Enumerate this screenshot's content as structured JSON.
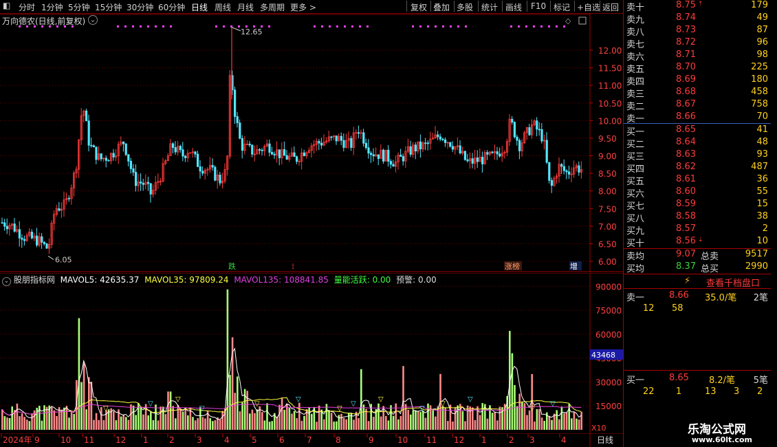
{
  "toolbar": {
    "periods": [
      "分时",
      "1分钟",
      "5分钟",
      "15分钟",
      "30分钟",
      "60分钟",
      "日线",
      "周线",
      "月线",
      "多周期",
      "更多 >"
    ],
    "active": "日线",
    "actions": [
      "复权",
      "叠加",
      "多股",
      "统计",
      "画线",
      "F10",
      "标记",
      "+自选",
      "返回"
    ]
  },
  "main": {
    "title": "万向德农(日线,前复权)",
    "y_ticks": [
      "12.00",
      "11.50",
      "11.00",
      "10.50",
      "10.00",
      "9.50",
      "9.00",
      "8.50",
      "8.00",
      "7.50",
      "7.00",
      "6.50",
      "6.00"
    ],
    "high_label": "12.65",
    "low_label": "6.05",
    "markers": [
      "跌",
      "涨榜",
      "增"
    ]
  },
  "indicator": {
    "name": "股朋指标网",
    "mavol5": "MAVOL5: 42635.37",
    "mavol35": "MAVOL35: 97809.24",
    "mavol135": "MAVOL135: 108841.85",
    "active": "量能活跃: 0.00",
    "warning": "预警: 0.00",
    "y_ticks": [
      "90000",
      "75000",
      "60000",
      "45000",
      "30000",
      "15000"
    ],
    "current": "43468",
    "multiplier": "X10"
  },
  "time_axis": {
    "labels": [
      "2024年",
      "9",
      "10",
      "11",
      "12",
      "1",
      "2",
      "3",
      "4",
      "5",
      "6",
      "7",
      "8",
      "9",
      "10",
      "11",
      "12",
      "1",
      "2",
      "3",
      "4"
    ],
    "period": "日线"
  },
  "book": {
    "sell": [
      {
        "label": "卖十",
        "price": "8.75",
        "vol": "179",
        "arrow": "up"
      },
      {
        "label": "卖九",
        "price": "8.74",
        "vol": "49"
      },
      {
        "label": "卖八",
        "price": "8.73",
        "vol": "87"
      },
      {
        "label": "卖七",
        "price": "8.72",
        "vol": "96"
      },
      {
        "label": "卖六",
        "price": "8.71",
        "vol": "98"
      },
      {
        "label": "卖五",
        "price": "8.70",
        "vol": "225"
      },
      {
        "label": "卖四",
        "price": "8.69",
        "vol": "180"
      },
      {
        "label": "卖三",
        "price": "8.68",
        "vol": "458"
      },
      {
        "label": "卖二",
        "price": "8.67",
        "vol": "758"
      },
      {
        "label": "卖一",
        "price": "8.66",
        "vol": "70"
      }
    ],
    "buy": [
      {
        "label": "买一",
        "price": "8.65",
        "vol": "41"
      },
      {
        "label": "买二",
        "price": "8.64",
        "vol": "48"
      },
      {
        "label": "买三",
        "price": "8.63",
        "vol": "93"
      },
      {
        "label": "买四",
        "price": "8.62",
        "vol": "487"
      },
      {
        "label": "买五",
        "price": "8.61",
        "vol": "36"
      },
      {
        "label": "买六",
        "price": "8.60",
        "vol": "55"
      },
      {
        "label": "买七",
        "price": "8.59",
        "vol": "15"
      },
      {
        "label": "买八",
        "price": "8.58",
        "vol": "38"
      },
      {
        "label": "买九",
        "price": "8.57",
        "vol": "2"
      },
      {
        "label": "买十",
        "price": "8.56",
        "vol": "10",
        "arrow": "down"
      }
    ],
    "avg_sell_label": "卖均",
    "avg_sell_price": "9.07",
    "total_sell_label": "总卖",
    "total_sell": "9517",
    "avg_buy_label": "买均",
    "avg_buy_price": "8.37",
    "total_buy_label": "总买",
    "total_buy": "2990",
    "view_button": "查看千档盘口",
    "ask1": {
      "label": "卖一",
      "price": "8.66",
      "qty": "35.0/笔",
      "count": "2笔",
      "orders": [
        "12",
        "58"
      ]
    },
    "bid1": {
      "label": "买一",
      "price": "8.65",
      "qty": "8.2/笔",
      "count": "5笔",
      "orders": [
        "22",
        "1",
        "13",
        "3",
        "2"
      ]
    }
  },
  "watermark": {
    "title": "乐淘公式网",
    "url": "www.60lt.com"
  }
}
